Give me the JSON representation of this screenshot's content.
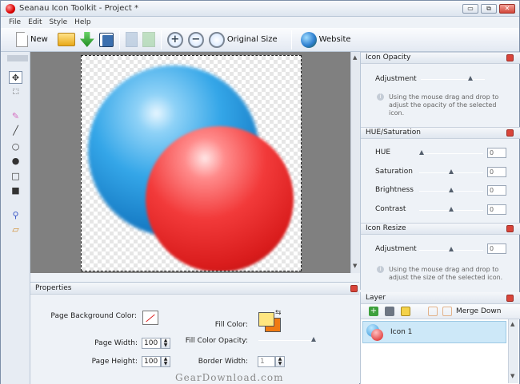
{
  "window": {
    "title": "Seanau Icon Toolkit - Project *",
    "min": "▭",
    "restore": "⧉",
    "close": "✕"
  },
  "menu": [
    "File",
    "Edit",
    "Style",
    "Help"
  ],
  "toolbar": {
    "new_label": "New",
    "original_size_label": "Original Size",
    "website_label": "Website"
  },
  "icon_opacity": {
    "title": "Icon Opacity",
    "adjustment_label": "Adjustment",
    "adjustment_value": 0.8,
    "hint": "Using the mouse drag and drop to adjust the opacity of the selected icon."
  },
  "hue_saturation": {
    "title": "HUE/Saturation",
    "rows": [
      {
        "label": "HUE",
        "value": "0",
        "level": 0.0
      },
      {
        "label": "Saturation",
        "value": "0",
        "level": 0.5
      },
      {
        "label": "Brightness",
        "value": "0",
        "level": 0.5
      },
      {
        "label": "Contrast",
        "value": "0",
        "level": 0.5
      }
    ]
  },
  "icon_resize": {
    "title": "Icon Resize",
    "adjustment_label": "Adjustment",
    "adjustment_value": "0",
    "level": 0.5,
    "hint": "Using the mouse drag and drop to adjust the size of the selected icon."
  },
  "properties": {
    "title": "Properties",
    "page_bg_label": "Page Background Color:",
    "page_width_label": "Page Width:",
    "page_width": "100",
    "page_height_label": "Page Height:",
    "page_height": "100",
    "fill_color_label": "Fill Color:",
    "fill_opacity_label": "Fill Color Opacity:",
    "fill_opacity_level": 1.0,
    "border_width_label": "Border Width:",
    "border_width": "1",
    "fill_primary": "#ffe680",
    "fill_secondary": "#f07a12"
  },
  "layer": {
    "title": "Layer",
    "merge_down_label": "Merge Down",
    "items": [
      {
        "name": "Icon 1"
      }
    ]
  },
  "watermark": "GearDownload.com"
}
